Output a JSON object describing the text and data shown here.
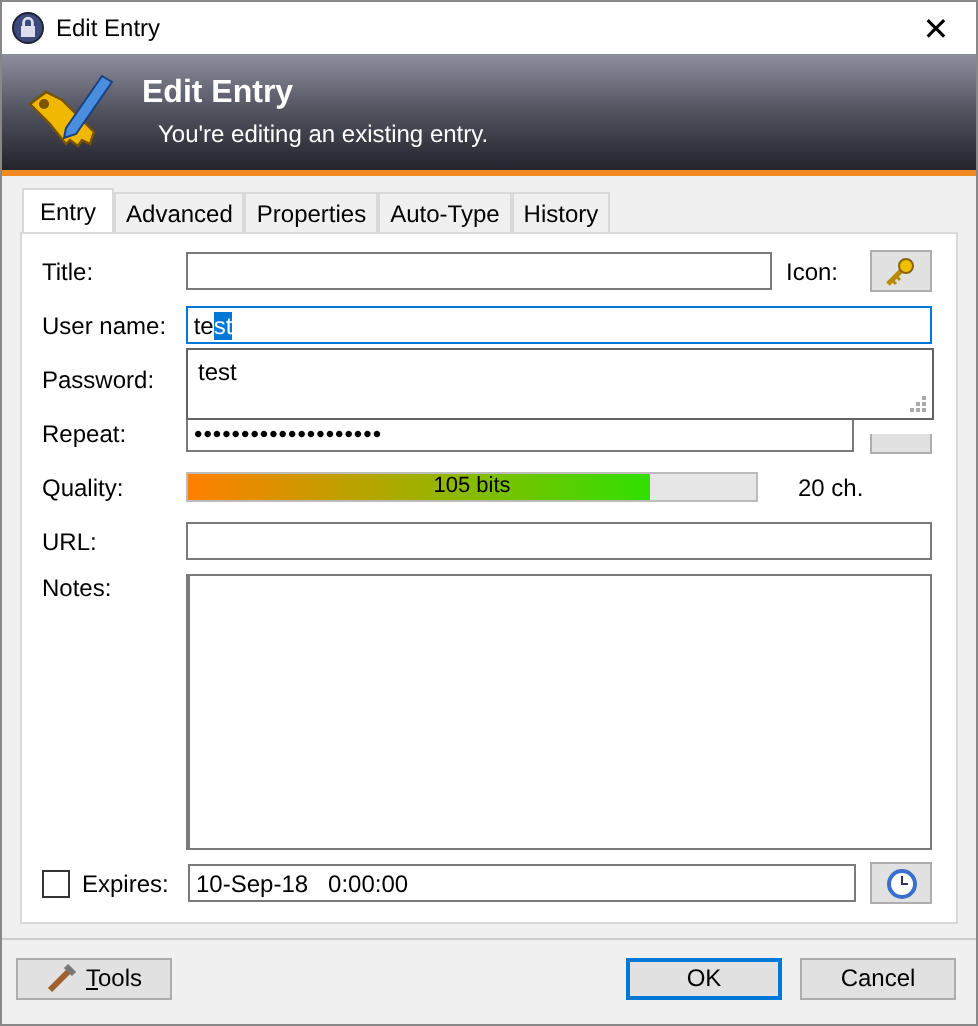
{
  "window": {
    "title": "Edit Entry",
    "close": "✕"
  },
  "banner": {
    "title": "Edit Entry",
    "subtitle": "You're editing an existing entry."
  },
  "tabs": [
    {
      "label": "Entry",
      "selected": true
    },
    {
      "label": "Advanced",
      "selected": false
    },
    {
      "label": "Properties",
      "selected": false
    },
    {
      "label": "Auto-Type",
      "selected": false
    },
    {
      "label": "History",
      "selected": false
    }
  ],
  "fields": {
    "title_label": "Title:",
    "icon_label": "Icon:",
    "username_label": "User name:",
    "username_value": "te",
    "username_selected": "st",
    "password_label": "Password:",
    "repeat_label": "Repeat:",
    "repeat_value": "••••••••••••••••••••",
    "quality_label": "Quality:",
    "quality": {
      "level": 0.815,
      "reading": "105 bits"
    },
    "length": "20 ch.",
    "url_label": "URL:",
    "notes_label": "Notes:"
  },
  "autocomplete": [
    "test"
  ],
  "expires": {
    "checked": false,
    "label": "Expires:",
    "value": "10-Sep-18   0:00:00"
  },
  "buttons": {
    "tools": "Tools",
    "ok": "OK",
    "cancel": "Cancel"
  }
}
